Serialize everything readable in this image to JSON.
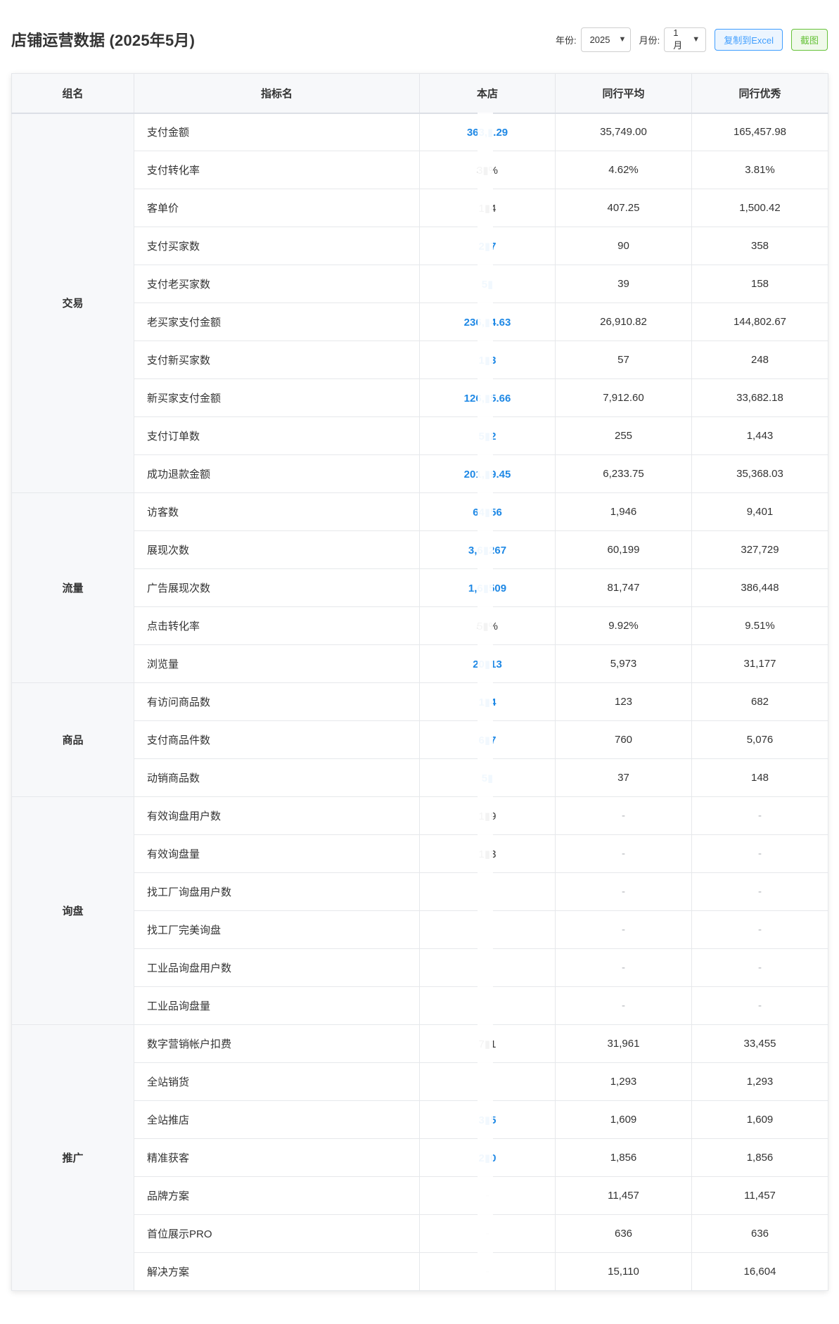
{
  "header": {
    "title": "店铺运营数据 (2025年5月)",
    "year_label": "年份:",
    "year_value": "2025",
    "month_label": "月份:",
    "month_value": "1月",
    "copy_excel_label": "复制到Excel",
    "screenshot_label": "截图"
  },
  "table": {
    "columns": [
      "组名",
      "指标名",
      "本店",
      "同行平均",
      "同行优秀"
    ],
    "groups": [
      {
        "name": "交易",
        "rows": [
          {
            "metric": "支付金额",
            "own": "363,▮.29",
            "avg": "35,749.00",
            "top": "165,457.98",
            "highlight": true
          },
          {
            "metric": "支付转化率",
            "own": "3▮%",
            "avg": "4.62%",
            "top": "3.81%",
            "highlight": false
          },
          {
            "metric": "客单价",
            "own": "1▮4",
            "avg": "407.25",
            "top": "1,500.42",
            "highlight": false
          },
          {
            "metric": "支付买家数",
            "own": "2▮7",
            "avg": "90",
            "top": "358",
            "highlight": true
          },
          {
            "metric": "支付老买家数",
            "own": "5▮",
            "avg": "39",
            "top": "158",
            "highlight": true
          },
          {
            "metric": "老买家支付金额",
            "own": "236,▮4.63",
            "avg": "26,910.82",
            "top": "144,802.67",
            "highlight": true
          },
          {
            "metric": "支付新买家数",
            "own": "1▮3",
            "avg": "57",
            "top": "248",
            "highlight": true
          },
          {
            "metric": "新买家支付金额",
            "own": "126,▮5.66",
            "avg": "7,912.60",
            "top": "33,682.18",
            "highlight": true
          },
          {
            "metric": "支付订单数",
            "own": "5▮2",
            "avg": "255",
            "top": "1,443",
            "highlight": true
          },
          {
            "metric": "成功退款金额",
            "own": "201,▮9.45",
            "avg": "6,233.75",
            "top": "35,368.03",
            "highlight": true
          }
        ]
      },
      {
        "name": "流量",
        "rows": [
          {
            "metric": "访客数",
            "own": "64▮56",
            "avg": "1,946",
            "top": "9,401",
            "highlight": true
          },
          {
            "metric": "展现次数",
            "own": "3,6▮267",
            "avg": "60,199",
            "top": "327,729",
            "highlight": true
          },
          {
            "metric": "广告展现次数",
            "own": "1,6▮509",
            "avg": "81,747",
            "top": "386,448",
            "highlight": true
          },
          {
            "metric": "点击转化率",
            "own": "5▮%",
            "avg": "9.92%",
            "top": "9.51%",
            "highlight": false
          },
          {
            "metric": "浏览量",
            "own": "20▮13",
            "avg": "5,973",
            "top": "31,177",
            "highlight": true
          }
        ]
      },
      {
        "name": "商品",
        "rows": [
          {
            "metric": "有访问商品数",
            "own": "1▮4",
            "avg": "123",
            "top": "682",
            "highlight": true
          },
          {
            "metric": "支付商品件数",
            "own": "6▮7",
            "avg": "760",
            "top": "5,076",
            "highlight": true
          },
          {
            "metric": "动销商品数",
            "own": "5▮",
            "avg": "37",
            "top": "148",
            "highlight": true
          }
        ]
      },
      {
        "name": "询盘",
        "rows": [
          {
            "metric": "有效询盘用户数",
            "own": "1▮9",
            "avg": "-",
            "top": "-",
            "highlight": false
          },
          {
            "metric": "有效询盘量",
            "own": "1▮3",
            "avg": "-",
            "top": "-",
            "highlight": false
          },
          {
            "metric": "找工厂询盘用户数",
            "own": "",
            "avg": "-",
            "top": "-",
            "highlight": false
          },
          {
            "metric": "找工厂完美询盘",
            "own": "",
            "avg": "-",
            "top": "-",
            "highlight": false
          },
          {
            "metric": "工业品询盘用户数",
            "own": "",
            "avg": "-",
            "top": "-",
            "highlight": false
          },
          {
            "metric": "工业品询盘量",
            "own": "",
            "avg": "-",
            "top": "-",
            "highlight": false
          }
        ]
      },
      {
        "name": "推广",
        "rows": [
          {
            "metric": "数字营销帐户扣费",
            "own": "7▮1",
            "avg": "31,961",
            "top": "33,455",
            "highlight": false
          },
          {
            "metric": "全站销货",
            "own": "",
            "avg": "1,293",
            "top": "1,293",
            "highlight": false
          },
          {
            "metric": "全站推店",
            "own": "3▮5",
            "avg": "1,609",
            "top": "1,609",
            "highlight": true
          },
          {
            "metric": "精准获客",
            "own": "2▮0",
            "avg": "1,856",
            "top": "1,856",
            "highlight": true
          },
          {
            "metric": "品牌方案",
            "own": "-",
            "avg": "11,457",
            "top": "11,457",
            "highlight": false
          },
          {
            "metric": "首位展示PRO",
            "own": "-",
            "avg": "636",
            "top": "636",
            "highlight": false
          },
          {
            "metric": "解决方案",
            "own": "-",
            "avg": "15,110",
            "top": "16,604",
            "highlight": false
          }
        ]
      }
    ]
  }
}
